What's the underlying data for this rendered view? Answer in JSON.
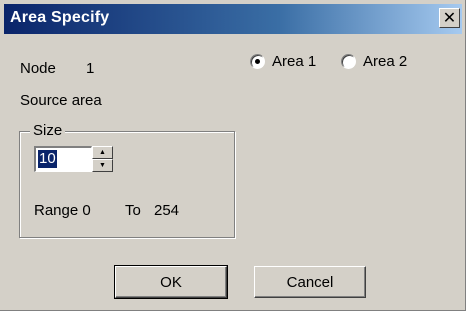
{
  "window": {
    "title": "Area Specify",
    "close_label": "✕"
  },
  "node": {
    "label": "Node",
    "value": "1"
  },
  "source_area_label": "Source area",
  "areas": {
    "selected": "Area 1",
    "options": [
      "Area 1",
      "Area 2"
    ]
  },
  "size_group": {
    "title": "Size",
    "value": "10",
    "up_arrow": "▲",
    "down_arrow": "▼",
    "range_label": "Range 0",
    "to_label": "To",
    "range_max": "254"
  },
  "buttons": {
    "ok": "OK",
    "cancel": "Cancel"
  }
}
